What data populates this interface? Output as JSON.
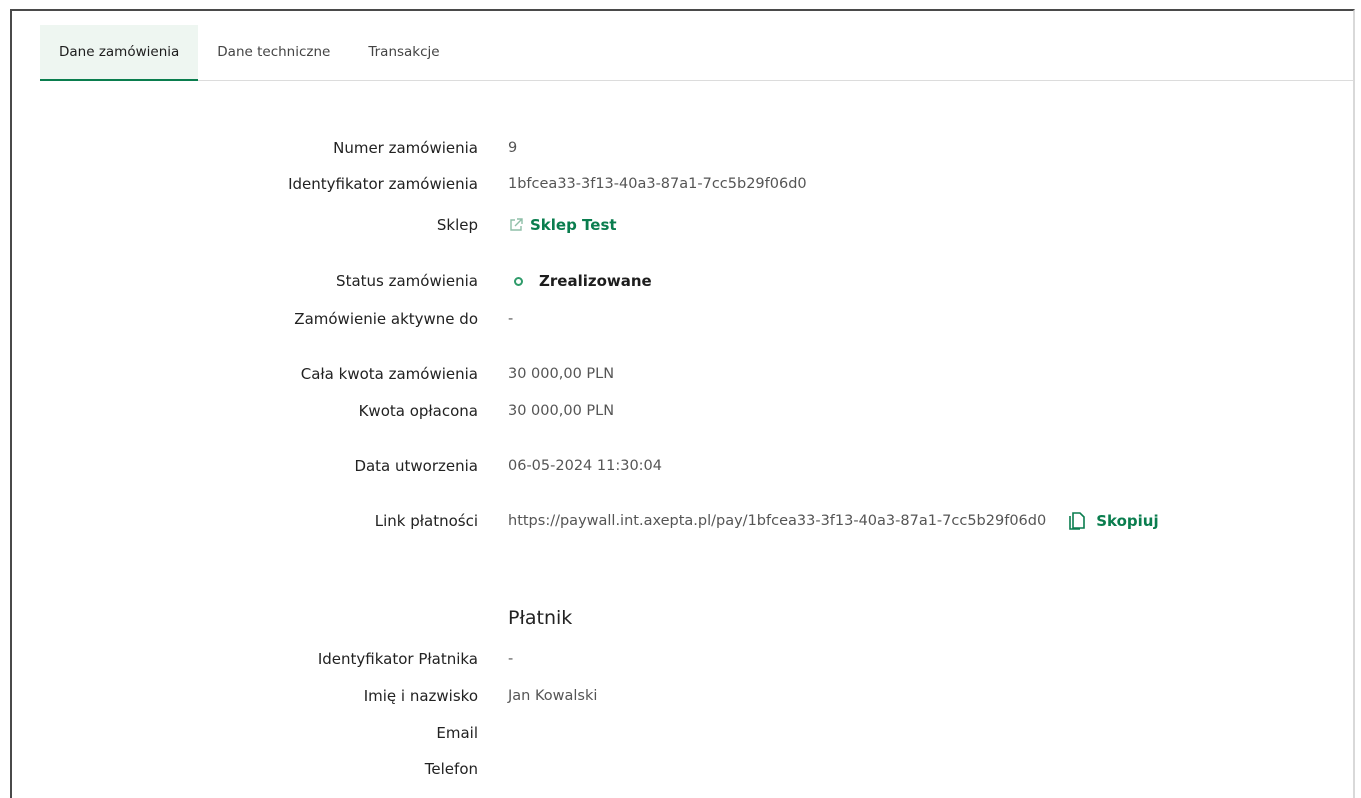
{
  "tabs": [
    {
      "label": "Dane zamówienia",
      "active": true
    },
    {
      "label": "Dane techniczne",
      "active": false
    },
    {
      "label": "Transakcje",
      "active": false
    }
  ],
  "order": {
    "number_label": "Numer zamówienia",
    "number": "9",
    "id_label": "Identyfikator zamówienia",
    "id": "1bfcea33-3f13-40a3-87a1-7cc5b29f06d0",
    "shop_label": "Sklep",
    "shop": "Sklep Test",
    "status_label": "Status zamówienia",
    "status": "Zrealizowane",
    "active_until_label": "Zamówienie aktywne do",
    "active_until": "-",
    "total_label": "Cała kwota zamówienia",
    "total": "30 000,00 PLN",
    "paid_label": "Kwota opłacona",
    "paid": "30 000,00 PLN",
    "created_label": "Data utworzenia",
    "created": "06-05-2024 11:30:04",
    "link_label": "Link płatności",
    "link": "https://paywall.int.axepta.pl/pay/1bfcea33-3f13-40a3-87a1-7cc5b29f06d0",
    "copy_label": "Skopiuj"
  },
  "payer": {
    "title": "Płatnik",
    "id_label": "Identyfikator Płatnika",
    "id": "-",
    "name_label": "Imię i nazwisko",
    "name": "Jan Kowalski",
    "email_label": "Email",
    "email": "",
    "phone_label": "Telefon",
    "phone": ""
  },
  "colors": {
    "accent": "#0a7d4e",
    "status_dot": "#2f9b6a",
    "active_tab_bg": "#eef6f1"
  },
  "icons": {
    "shop": "external-link-icon",
    "status": "status-circle-icon",
    "copy": "copy-icon"
  }
}
